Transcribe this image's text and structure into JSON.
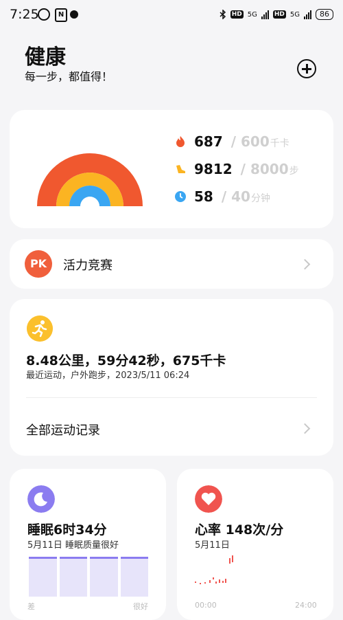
{
  "status_bar": {
    "time": "7:25",
    "network_1": "5G",
    "network_2": "5G",
    "hd_1": "HD",
    "hd_2": "HD",
    "battery": "86",
    "nfc": "N"
  },
  "header": {
    "title": "健康",
    "subtitle": "每一步，都值得！"
  },
  "activity": {
    "calories": {
      "value": "687",
      "goal": "/ 600",
      "unit": "千卡",
      "color": "#f0582f"
    },
    "steps": {
      "value": "9812",
      "goal": "/ 8000",
      "unit": "步",
      "color": "#fbb422"
    },
    "minutes": {
      "value": "58",
      "goal": "/ 40",
      "unit": "分钟",
      "color": "#3aa6f2"
    },
    "progress": {
      "calories": 1.145,
      "steps": 1.2265,
      "minutes": 1.45
    }
  },
  "pk": {
    "badge": "PK",
    "label": "活力竞赛",
    "color": "#f05f3c"
  },
  "workout": {
    "summary": "8.48公里，59分42秒，675千卡",
    "detail": "最近运动，户外跑步，2023/5/11 06:24",
    "all_records": "全部运动记录"
  },
  "sleep": {
    "title": "睡眠6时34分",
    "detail": "5月11日  睡眠质量很好",
    "axis_left": "差",
    "axis_right": "很好",
    "color": "#8b7cf0"
  },
  "heart": {
    "title": "心率 148次/分",
    "date": "5月11日",
    "axis_left": "00:00",
    "axis_right": "24:00",
    "color": "#f0544f"
  }
}
